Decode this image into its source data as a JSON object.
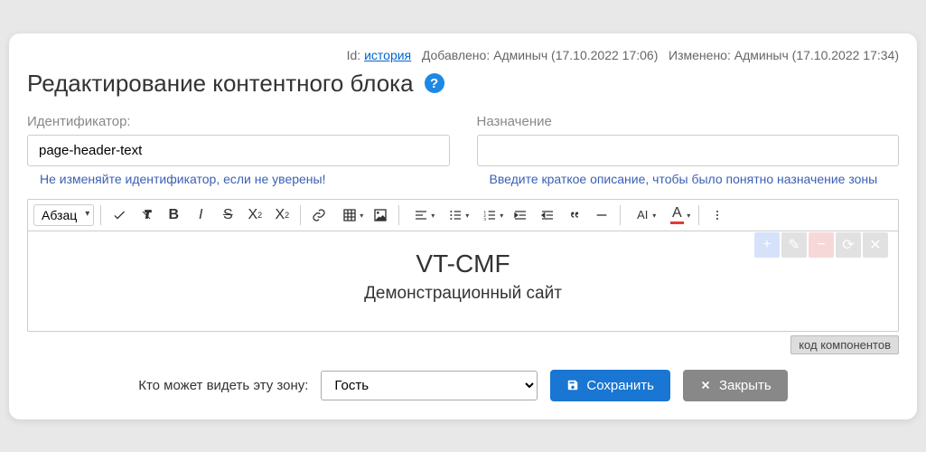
{
  "meta": {
    "id_label": "Id:",
    "id_link": "история",
    "added_label": "Добавлено:",
    "added_by": "Админыч (17.10.2022 17:06)",
    "changed_label": "Изменено:",
    "changed_by": "Админыч (17.10.2022 17:34)"
  },
  "title": "Редактирование контентного блока",
  "help_glyph": "?",
  "fields": {
    "identifier": {
      "label": "Идентификатор:",
      "value": "page-header-text",
      "hint": "Не изменяйте идентификатор, если не уверены!"
    },
    "purpose": {
      "label": "Назначение",
      "value": "",
      "hint": "Введите краткое описание, чтобы было понятно назначение зоны"
    }
  },
  "toolbar": {
    "format_select": "Абзац"
  },
  "editor": {
    "heading": "VT-CMF",
    "subline": "Демонстрационный сайт"
  },
  "code_link": "код компонентов",
  "footer": {
    "visibility_label": "Кто может видеть эту зону:",
    "visibility_value": "Гость",
    "save": "Сохранить",
    "close": "Закрыть"
  },
  "side_tabs": [
    "+",
    "✎",
    "−",
    "⟳",
    "✕"
  ]
}
